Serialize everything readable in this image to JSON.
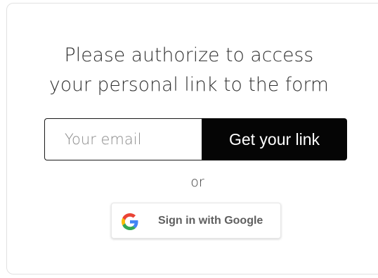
{
  "auth": {
    "headline_line1": "Please authorize to access",
    "headline_line2": "your personal link to the form",
    "email_placeholder": "Your email",
    "submit_label": "Get your link",
    "separator": "or",
    "google_label": "Sign in with Google",
    "google_icon": "google-g-logo"
  },
  "colors": {
    "button_bg": "#050505",
    "button_text": "#ffffff",
    "card_border": "#e1e1e1",
    "google_blue": "#4285F4",
    "google_red": "#EA4335",
    "google_yellow": "#FBBC05",
    "google_green": "#34A853"
  }
}
